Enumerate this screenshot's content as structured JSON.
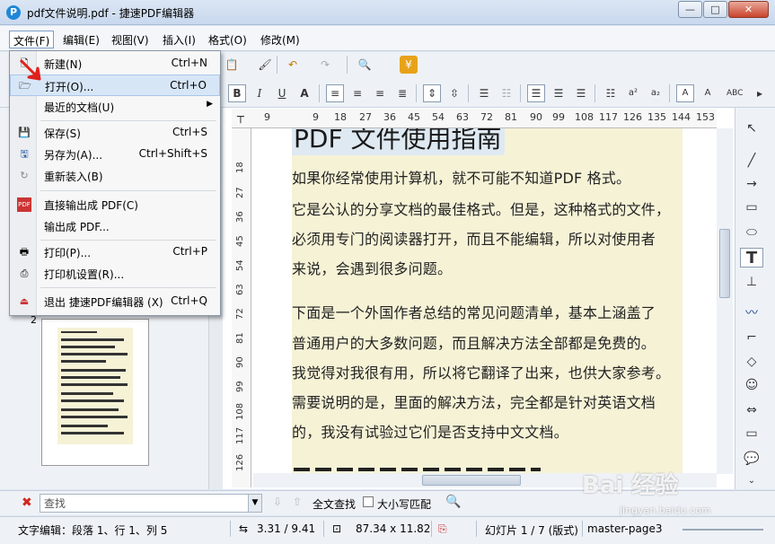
{
  "window": {
    "title": "pdf文件说明.pdf - 捷速PDF编辑器",
    "app_icon": "P",
    "controls": {
      "minimize": "—",
      "maximize": "□",
      "close": "✕"
    }
  },
  "menubar": [
    {
      "label": "文件(F)"
    },
    {
      "label": "编辑(E)"
    },
    {
      "label": "视图(V)"
    },
    {
      "label": "插入(I)"
    },
    {
      "label": "格式(O)"
    },
    {
      "label": "修改(M)"
    }
  ],
  "file_menu": [
    {
      "label": "新建(N)",
      "shortcut": "Ctrl+N",
      "icon": "new-file-icon"
    },
    {
      "label": "打开(O)...",
      "shortcut": "Ctrl+O",
      "icon": "open-folder-icon"
    },
    {
      "label": "最近的文档(U)",
      "shortcut": "",
      "icon": "",
      "submenu": true
    },
    {
      "label": "保存(S)",
      "shortcut": "Ctrl+S",
      "icon": "save-icon"
    },
    {
      "label": "另存为(A)...",
      "shortcut": "Ctrl+Shift+S",
      "icon": "save-as-icon"
    },
    {
      "label": "重新装入(B)",
      "shortcut": "",
      "icon": "reload-icon"
    },
    {
      "label": "直接输出成 PDF(C)",
      "shortcut": "",
      "icon": "pdf-icon"
    },
    {
      "label": "输出成 PDF...",
      "shortcut": "",
      "icon": ""
    },
    {
      "label": "打印(P)...",
      "shortcut": "Ctrl+P",
      "icon": "print-icon"
    },
    {
      "label": "打印机设置(R)...",
      "shortcut": "",
      "icon": "printer-settings-icon"
    },
    {
      "label": "退出 捷速PDF编辑器 (X)",
      "shortcut": "Ctrl+Q",
      "icon": "exit-icon"
    }
  ],
  "ruler": {
    "h_ticks": [
      "9",
      "9",
      "18",
      "27",
      "36",
      "45",
      "54",
      "63",
      "72",
      "81",
      "90",
      "99",
      "108",
      "117",
      "126",
      "135",
      "144",
      "153"
    ],
    "v_ticks": [
      "18",
      "27",
      "36",
      "45",
      "54",
      "63",
      "72",
      "81",
      "90",
      "99",
      "108",
      "117",
      "126"
    ]
  },
  "document": {
    "heading": "PDF 文件使用指南",
    "lines": [
      "如果你经常使用计算机，就不可能不知道PDF 格式。",
      "它是公认的分享文档的最佳格式。但是，这种格式的文件，",
      "必须用专门的阅读器打开，而且不能编辑，所以对使用者",
      "来说，会遇到很多问题。",
      "下面是一个外国作者总结的常见问题清单，基本上涵盖了",
      "普通用户的大多数问题，而且解决方法全部都是免费的。",
      "我觉得对我很有用，所以将它翻译了出来，也供大家参考。",
      "需要说明的是，里面的解决方法，完全都是针对英语文档",
      "的，我没有试验过它们是否支持中文文档。"
    ]
  },
  "thumbnail": {
    "page_number": "2"
  },
  "findbar": {
    "placeholder": "查找",
    "find_all": "全文查找",
    "match_case": "大小写匹配"
  },
  "statusbar": {
    "edit_status": "文字编辑：段落 1、行 1、列 5",
    "position": "3.31 / 9.41",
    "size": "87.34 x 11.82",
    "slide": "幻灯片 1 / 7 (版式)",
    "master": "master-page3"
  },
  "watermark": {
    "text": "Bai 经验",
    "url": "jingyan.baidu.com"
  },
  "colors": {
    "accent": "#1e88d6",
    "text_frame": "#f6f2d6",
    "close": "#c9432c"
  }
}
